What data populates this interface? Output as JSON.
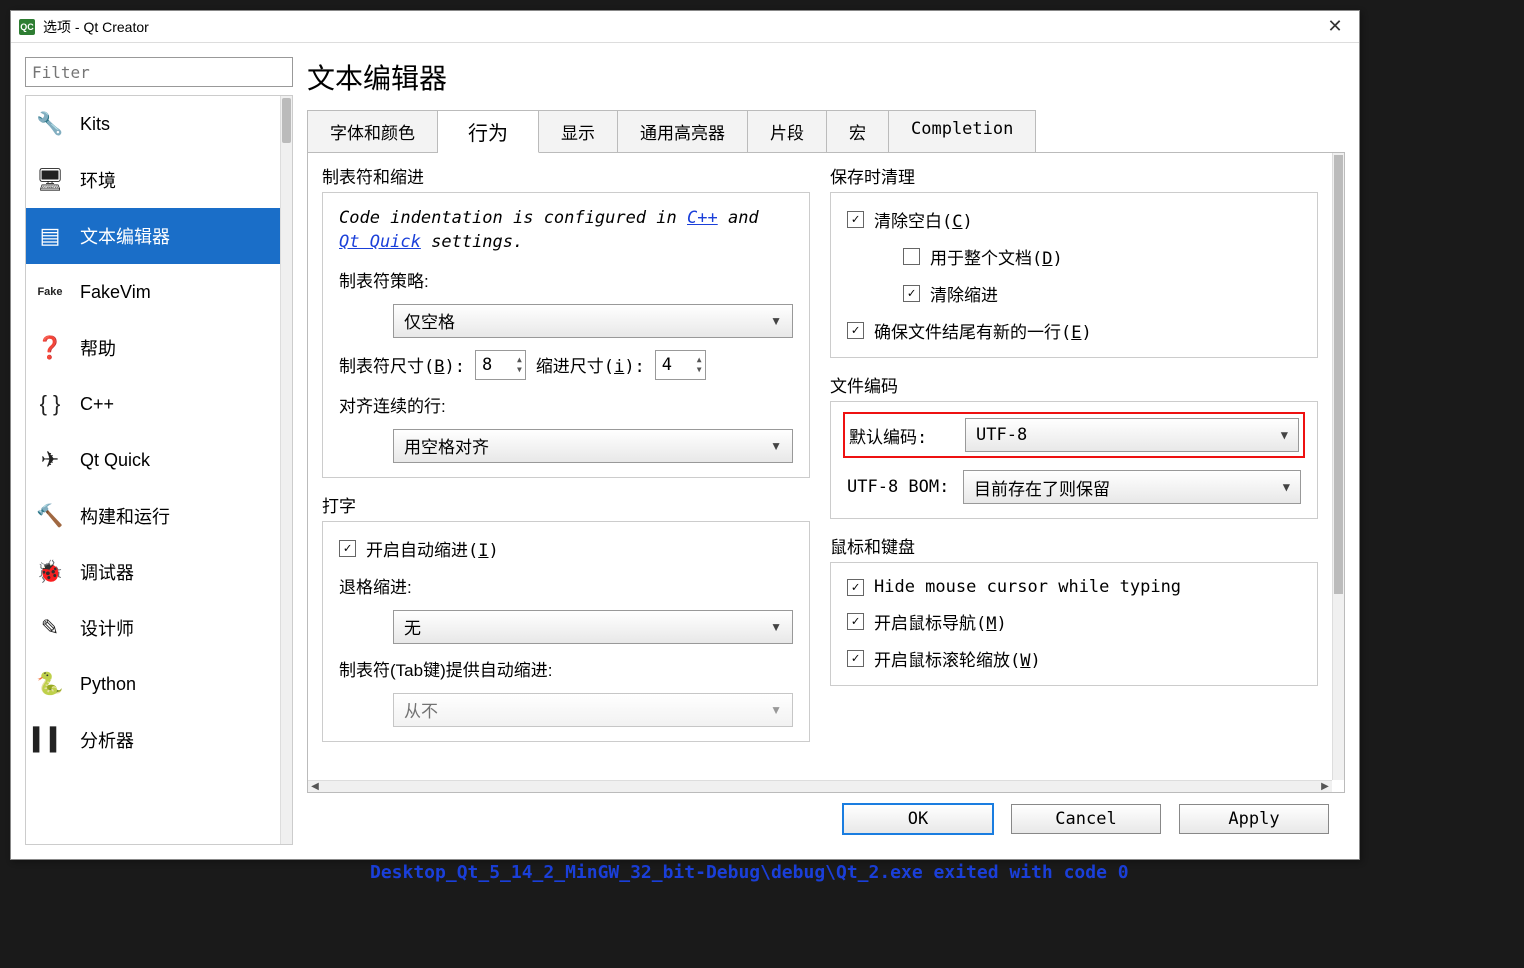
{
  "window": {
    "title": "选项 - Qt Creator"
  },
  "filter": {
    "placeholder": "Filter"
  },
  "categories": [
    {
      "id": "kits",
      "label": "Kits",
      "icon": "kits"
    },
    {
      "id": "env",
      "label": "环境",
      "icon": "monitor"
    },
    {
      "id": "editor",
      "label": "文本编辑器",
      "icon": "lines",
      "selected": true
    },
    {
      "id": "fakevim",
      "label": "FakeVim",
      "icon": "fake"
    },
    {
      "id": "help",
      "label": "帮助",
      "icon": "help"
    },
    {
      "id": "cpp",
      "label": "C++",
      "icon": "code"
    },
    {
      "id": "qtquick",
      "label": "Qt Quick",
      "icon": "plane"
    },
    {
      "id": "build",
      "label": "构建和运行",
      "icon": "hammer"
    },
    {
      "id": "debug",
      "label": "调试器",
      "icon": "bug"
    },
    {
      "id": "designer",
      "label": "设计师",
      "icon": "pencil"
    },
    {
      "id": "python",
      "label": "Python",
      "icon": "python"
    },
    {
      "id": "analyzer",
      "label": "分析器",
      "icon": "bars"
    }
  ],
  "page": {
    "heading": "文本编辑器",
    "tabs": [
      "字体和颜色",
      "行为",
      "显示",
      "通用高亮器",
      "片段",
      "宏",
      "Completion"
    ],
    "active_tab": 1
  },
  "left_col": {
    "tabs_indent": {
      "title": "制表符和缩进",
      "info_pre": "Code indentation is configured in ",
      "info_link1": "C++",
      "info_mid": " and ",
      "info_link2": "Qt Quick",
      "info_post": " settings.",
      "policy_label": "制表符策略:",
      "policy_value": "仅空格",
      "tabsize_label_pre": "制表符尺寸(",
      "tabsize_label_u": "B",
      "tabsize_label_post": "):",
      "tabsize_value": "8",
      "indent_label_pre": "缩进尺寸(",
      "indent_label_u": "i",
      "indent_label_post": "):",
      "indent_value": "4",
      "align_label": "对齐连续的行:",
      "align_value": "用空格对齐"
    },
    "typing": {
      "title": "打字",
      "auto_indent_pre": "开启自动缩进(",
      "auto_indent_u": "I",
      "auto_indent_post": ")",
      "backspace_label": "退格缩进:",
      "backspace_value": "无",
      "tabkey_label": "制表符(Tab键)提供自动缩进:",
      "tabkey_value": "从不"
    }
  },
  "right_col": {
    "cleanup": {
      "title": "保存时清理",
      "clear_ws_pre": "清除空白(",
      "clear_ws_u": "C",
      "clear_ws_post": ")",
      "whole_doc_pre": "用于整个文档(",
      "whole_doc_u": "D",
      "whole_doc_post": ")",
      "clear_indent": "清除缩进",
      "ensure_newline_pre": "确保文件结尾有新的一行(",
      "ensure_newline_u": "E",
      "ensure_newline_post": ")"
    },
    "encoding": {
      "title": "文件编码",
      "default_label": "默认编码:",
      "default_value": "UTF-8",
      "bom_label": "UTF-8 BOM:",
      "bom_value": "目前存在了则保留"
    },
    "mouse": {
      "title": "鼠标和键盘",
      "hide_cursor": "Hide mouse cursor while typing",
      "mouse_nav_pre": "开启鼠标导航(",
      "mouse_nav_u": "M",
      "mouse_nav_post": ")",
      "wheel_zoom_pre": "开启鼠标滚轮缩放(",
      "wheel_zoom_u": "W",
      "wheel_zoom_post": ")"
    }
  },
  "buttons": {
    "ok": "OK",
    "cancel": "Cancel",
    "apply": "Apply"
  },
  "bg_text": "Desktop_Qt_5_14_2_MinGW_32_bit-Debug\\debug\\Qt_2.exe exited with code 0"
}
